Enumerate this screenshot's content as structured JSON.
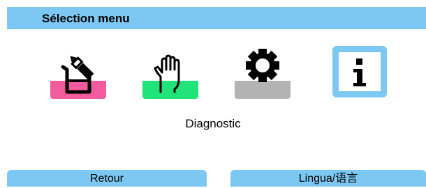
{
  "header": {
    "title": "Sélection menu"
  },
  "menu": {
    "items": [
      {
        "name": "calibration",
        "icon": "beaker-pen-icon",
        "color": "#f25b9c"
      },
      {
        "name": "maintenance",
        "icon": "hand-icon",
        "color": "#20e37a"
      },
      {
        "name": "parameters",
        "icon": "gear-icon",
        "color": "#b3b3b3"
      },
      {
        "name": "diagnostic",
        "icon": "info-icon",
        "color": "#7cc8f3"
      }
    ],
    "selected_label": "Diagnostic"
  },
  "softkeys": {
    "left_label": "Retour",
    "right_label": "Lingua/语言"
  },
  "colors": {
    "accent": "#7cc8f3",
    "background": "#ffffff"
  }
}
